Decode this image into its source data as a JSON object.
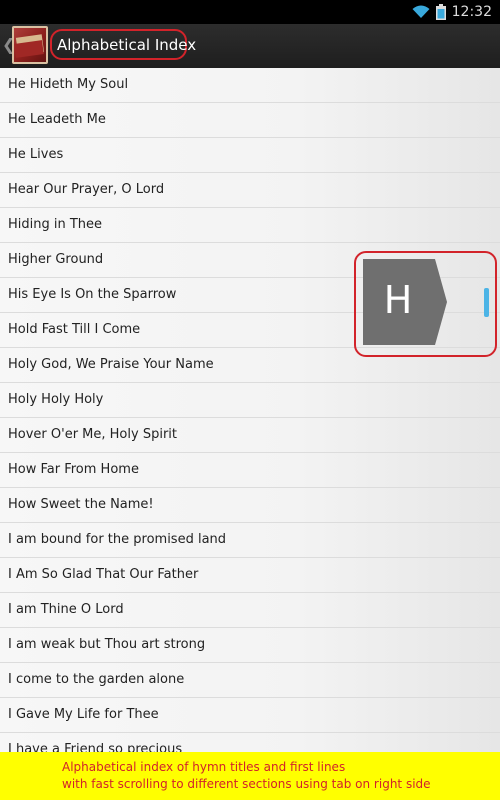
{
  "status_bar": {
    "time": "12:32",
    "wifi_icon": "wifi-icon",
    "battery_icon": "battery-icon"
  },
  "action_bar": {
    "title": "Alphabetical Index",
    "up_icon": "chevron-left-icon",
    "app_icon": "hymnal-book-icon"
  },
  "list": {
    "items": [
      "He Hideth My Soul",
      "He Leadeth Me",
      "He Lives",
      "Hear Our Prayer, O Lord",
      "Hiding in Thee",
      "Higher Ground",
      "His Eye Is On the Sparrow",
      "Hold Fast Till I Come",
      "Holy God, We Praise Your Name",
      "Holy Holy Holy",
      "Hover O'er Me, Holy Spirit",
      "How Far From Home",
      "How Sweet the Name!",
      "I am bound for the promised land",
      "I Am So Glad That Our Father",
      "I am Thine O Lord",
      "I am weak but Thou art strong",
      "I come to the garden alone",
      "I Gave My Life for Thee",
      "I have a Friend so precious"
    ]
  },
  "fast_scroll": {
    "section_letter": "H"
  },
  "caption": {
    "line1": "Alphabetical index of hymn titles and first lines",
    "line2": "with fast scrolling to different sections using tab on right side"
  },
  "colors": {
    "highlight": "#d2232a",
    "scroll_accent": "#4cb4e6",
    "caption_bg": "#ffff00",
    "index_tab": "#6f6f6f"
  }
}
